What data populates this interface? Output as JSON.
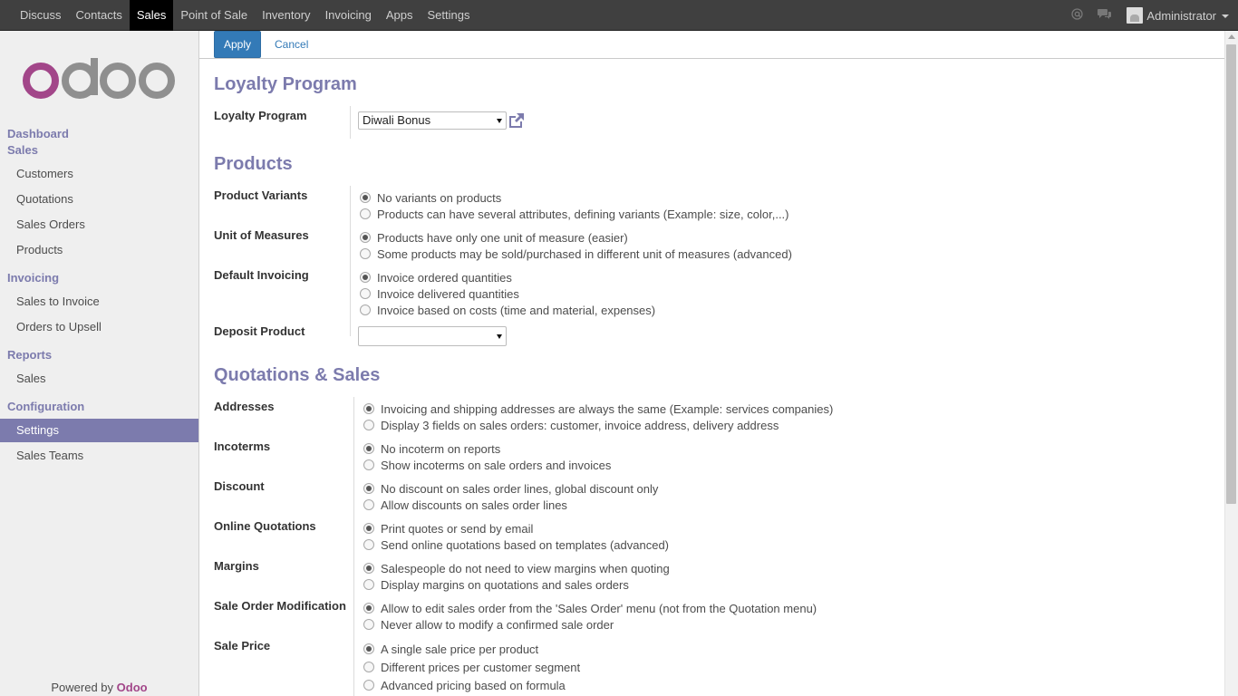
{
  "topbar": {
    "menu": [
      "Discuss",
      "Contacts",
      "Sales",
      "Point of Sale",
      "Inventory",
      "Invoicing",
      "Apps",
      "Settings"
    ],
    "active": "Sales",
    "user": "Administrator",
    "icons": [
      "at-icon",
      "chat-icon"
    ]
  },
  "sidebar": {
    "dashboard": "Dashboard",
    "sales_group": "Sales",
    "sales_items": [
      "Customers",
      "Quotations",
      "Sales Orders",
      "Products"
    ],
    "invoicing_group": "Invoicing",
    "invoicing_items": [
      "Sales to Invoice",
      "Orders to Upsell"
    ],
    "reports_group": "Reports",
    "reports_items": [
      "Sales"
    ],
    "config_group": "Configuration",
    "config_items": [
      "Settings",
      "Sales Teams"
    ],
    "active_item": "Settings",
    "powered_prefix": "Powered by ",
    "powered_brand": "Odoo"
  },
  "control_panel": {
    "apply": "Apply",
    "cancel": "Cancel"
  },
  "sections": {
    "loyalty": "Loyalty Program",
    "products": "Products",
    "quotations": "Quotations & Sales"
  },
  "fields": {
    "loyalty_program": {
      "label": "Loyalty Program",
      "value": "Diwali Bonus"
    },
    "product_variants": {
      "label": "Product Variants",
      "options": [
        "No variants on products",
        "Products can have several attributes, defining variants (Example: size, color,...)"
      ],
      "selected": 0
    },
    "unit_of_measures": {
      "label": "Unit of Measures",
      "options": [
        "Products have only one unit of measure (easier)",
        "Some products may be sold/purchased in different unit of measures (advanced)"
      ],
      "selected": 0
    },
    "default_invoicing": {
      "label": "Default Invoicing",
      "options": [
        "Invoice ordered quantities",
        "Invoice delivered quantities",
        "Invoice based on costs (time and material, expenses)"
      ],
      "selected": 0
    },
    "deposit_product": {
      "label": "Deposit Product",
      "value": ""
    },
    "addresses": {
      "label": "Addresses",
      "options": [
        "Invoicing and shipping addresses are always the same (Example: services companies)",
        "Display 3 fields on sales orders: customer, invoice address, delivery address"
      ],
      "selected": 0
    },
    "incoterms": {
      "label": "Incoterms",
      "options": [
        "No incoterm on reports",
        "Show incoterms on sale orders and invoices"
      ],
      "selected": 0
    },
    "discount": {
      "label": "Discount",
      "options": [
        "No discount on sales order lines, global discount only",
        "Allow discounts on sales order lines"
      ],
      "selected": 0
    },
    "online_quotations": {
      "label": "Online Quotations",
      "options": [
        "Print quotes or send by email",
        "Send online quotations based on templates (advanced)"
      ],
      "selected": 0
    },
    "margins": {
      "label": "Margins",
      "options": [
        "Salespeople do not need to view margins when quoting",
        "Display margins on quotations and sales orders"
      ],
      "selected": 0
    },
    "sale_order_modification": {
      "label": "Sale Order Modification",
      "options": [
        "Allow to edit sales order from the 'Sales Order' menu (not from the Quotation menu)",
        "Never allow to modify a confirmed sale order"
      ],
      "selected": 0
    },
    "sale_price": {
      "label": "Sale Price",
      "options": [
        "A single sale price per product",
        "Different prices per customer segment",
        "Advanced pricing based on formula"
      ],
      "selected": 0
    }
  },
  "colors": {
    "brand": "#7c7bad",
    "topbar": "#404040",
    "apply_button": "#337ab7",
    "logo_o": "#a24689",
    "logo_doo": "#8f8f8f"
  }
}
